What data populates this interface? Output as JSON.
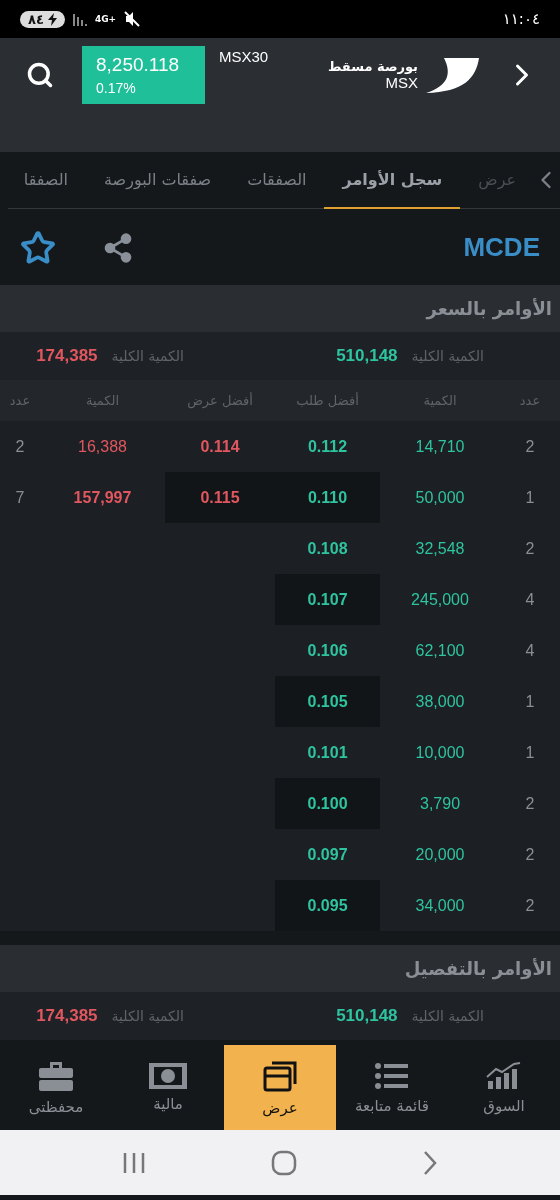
{
  "status_bar": {
    "battery": "٨٤",
    "network": "4G+",
    "time": "١١:٠٤"
  },
  "header": {
    "logo_line_1": "بورصة مسقط",
    "logo_line_2": "MSX",
    "index": {
      "name": "MSX30",
      "value": "8,250.118",
      "change": "0.17%",
      "up": true
    }
  },
  "tabs": [
    {
      "label": "عرض",
      "selected": false,
      "faded": true
    },
    {
      "label": "سجل الأوامر",
      "selected": true,
      "faded": false
    },
    {
      "label": "الصفقات",
      "selected": false,
      "faded": false
    },
    {
      "label": "صفقات البورصة",
      "selected": false,
      "faded": false
    },
    {
      "label": "الصفقا",
      "selected": false,
      "faded": false
    }
  ],
  "symbol": {
    "code": "MCDE",
    "favorite": false
  },
  "sections": [
    {
      "title": "الأوامر بالسعر",
      "totals": [
        {
          "color": "#2ec4a0",
          "label": "الكمية الكلية",
          "value": "510,148"
        },
        {
          "color": "#e0575f",
          "label": "الكمية الكلية",
          "value": "174,385"
        }
      ],
      "columns": [
        "عدد",
        "الكمية",
        "أفضل طلب",
        "أفضل عرض",
        "الكمية",
        "عدد"
      ],
      "rows": [
        {
          "bid_count": "2",
          "bid_qty": "14,710",
          "bid": "0.112",
          "ask": "0.114",
          "ask_qty": "16,388",
          "ask_count": "2"
        },
        {
          "bid_count": "1",
          "bid_qty": "50,000",
          "bid": "0.110",
          "ask": "0.115",
          "ask_qty": "157,997",
          "ask_count": "7"
        },
        {
          "bid_count": "2",
          "bid_qty": "32,548",
          "bid": "0.108"
        },
        {
          "bid_count": "4",
          "bid_qty": "245,000",
          "bid": "0.107"
        },
        {
          "bid_count": "4",
          "bid_qty": "62,100",
          "bid": "0.106"
        },
        {
          "bid_count": "1",
          "bid_qty": "38,000",
          "bid": "0.105"
        },
        {
          "bid_count": "1",
          "bid_qty": "10,000",
          "bid": "0.101"
        },
        {
          "bid_count": "2",
          "bid_qty": "3,790",
          "bid": "0.100"
        },
        {
          "bid_count": "2",
          "bid_qty": "20,000",
          "bid": "0.097"
        },
        {
          "bid_count": "2",
          "bid_qty": "34,000",
          "bid": "0.095"
        }
      ]
    },
    {
      "title": "الأوامر بالتفصيل",
      "totals": [
        {
          "color": "#2ec4a0",
          "label": "الكمية الكلية",
          "value": "510,148"
        },
        {
          "color": "#e0575f",
          "label": "الكمية الكلية",
          "value": "174,385"
        }
      ]
    }
  ],
  "bottom_nav": [
    {
      "kind": "market",
      "label": "السوق",
      "selected": false
    },
    {
      "kind": "watchlist",
      "label": "قائمة متابعة",
      "selected": false
    },
    {
      "kind": "view",
      "label": "عرض",
      "selected": true
    },
    {
      "kind": "finance",
      "label": "مالية",
      "selected": false
    },
    {
      "kind": "portfolio",
      "label": "محفظتى",
      "selected": false
    }
  ]
}
